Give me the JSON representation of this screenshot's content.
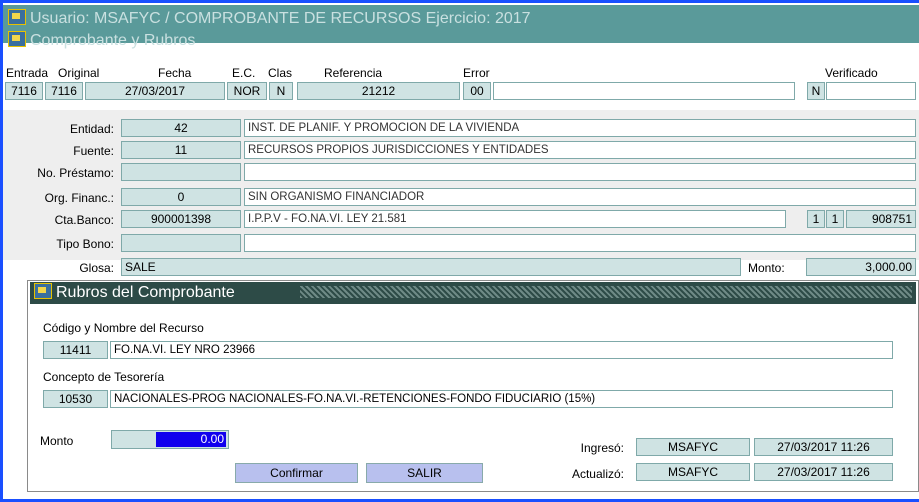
{
  "window": {
    "title": "Usuario: MSAFYC   /   COMPROBANTE DE RECURSOS  Ejercicio: 2017",
    "section_title": "Comprobante y Rubros"
  },
  "header_labels": {
    "entrada": "Entrada",
    "original": "Original",
    "fecha": "Fecha",
    "ec": "E.C.",
    "clas": "Clas",
    "referencia": "Referencia",
    "error": "Error",
    "verificado": "Verificado"
  },
  "header_values": {
    "entrada": "7116",
    "original": "7116",
    "fecha": "27/03/2017",
    "ec": "NOR",
    "clas": "N",
    "referencia": "21212",
    "error_code": "00",
    "error_text": "",
    "verificado_flag": "N",
    "verificado_text": ""
  },
  "details": {
    "entidad_label": "Entidad:",
    "entidad_code": "42",
    "entidad_name": "INST. DE PLANIF. Y PROMOCION DE LA VIVIENDA",
    "fuente_label": "Fuente:",
    "fuente_code": "11",
    "fuente_name": "RECURSOS PROPIOS JURISDICCIONES Y ENTIDADES",
    "prestamo_label": "No. Préstamo:",
    "prestamo_code": "",
    "prestamo_name": "",
    "orgfin_label": "Org. Financ.:",
    "orgfin_code": "0",
    "orgfin_name": "SIN ORGANISMO FINANCIADOR",
    "ctabanco_label": "Cta.Banco:",
    "ctabanco_code": "900001398",
    "ctabanco_name": "I.P.P.V - FO.NA.VI. LEY 21.581",
    "ctabanco_extra1": "1",
    "ctabanco_extra2": "1",
    "ctabanco_extra3": "908751",
    "tipobono_label": "Tipo Bono:",
    "tipobono_code": "",
    "tipobono_name": "",
    "glosa_label": "Glosa:",
    "glosa_value": "SALE",
    "monto_label": "Monto:",
    "monto_value": "3,000.00"
  },
  "rubros": {
    "title": "Rubros del Comprobante",
    "recurso_label": "Código y Nombre del Recurso",
    "recurso_code": "11411",
    "recurso_name": "FO.NA.VI. LEY NRO 23966",
    "concepto_label": "Concepto de Tesorería",
    "concepto_code": "10530",
    "concepto_name": "NACIONALES-PROG NACIONALES-FO.NA.VI.-RETENCIONES-FONDO FIDUCIARIO (15%)",
    "monto_label": "Monto",
    "monto_value": "0.00",
    "ingreso_label": "Ingresó:",
    "ingreso_user": "MSAFYC",
    "ingreso_date": "27/03/2017 11:26",
    "actualizo_label": "Actualizó:",
    "actualizo_user": "MSAFYC",
    "actualizo_date": "27/03/2017 11:26",
    "confirmar_label": "Confirmar",
    "salir_label": "SALIR"
  }
}
